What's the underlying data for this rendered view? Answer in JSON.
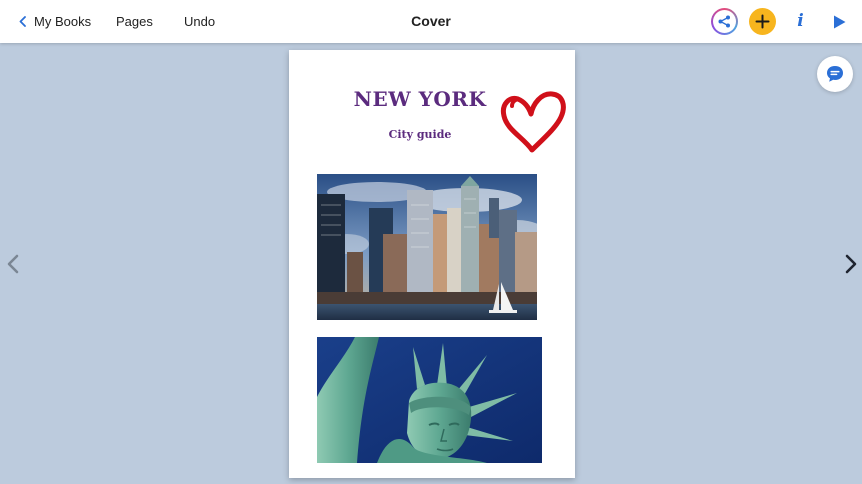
{
  "toolbar": {
    "back_label": "My Books",
    "pages_label": "Pages",
    "undo_label": "Undo",
    "title": "Cover",
    "info_label": "i"
  },
  "page": {
    "title": "NEW YORK",
    "subtitle": "City guide"
  },
  "icons": {
    "back": "chevron-left-icon",
    "share": "share-icon",
    "add": "plus-icon",
    "info": "info-icon",
    "play": "play-icon",
    "comment": "chat-bubble-icon",
    "prev": "chevron-left-icon",
    "next": "chevron-right-icon"
  },
  "colors": {
    "background": "#bccbdd",
    "accent_blue": "#2b6fd6",
    "add_yellow": "#f7b51e",
    "title_purple": "#5b2b7e",
    "heart_red": "#d0101a"
  }
}
